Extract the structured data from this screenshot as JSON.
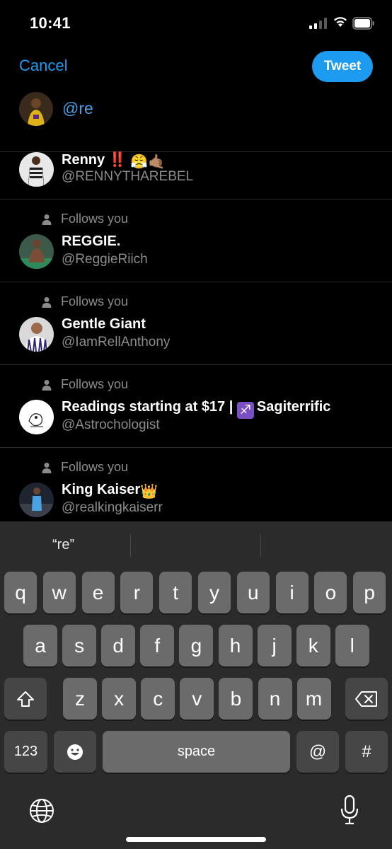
{
  "status_bar": {
    "time": "10:41"
  },
  "header": {
    "cancel_label": "Cancel",
    "tweet_label": "Tweet"
  },
  "compose": {
    "text": "@re"
  },
  "suggestions": [
    {
      "name": "Renny ‼️",
      "name_emoji": "😤🤙🏽",
      "handle": "@RENNYTHAREBEL",
      "follows_you": false
    },
    {
      "name": "REGGIE.",
      "handle": "@ReggieRiich",
      "follows_you": true,
      "follows_label": "Follows you"
    },
    {
      "name": "Gentle Giant",
      "handle": "@IamRellAnthony",
      "follows_you": true,
      "follows_label": "Follows you"
    },
    {
      "name": "Readings starting at $17 | ",
      "name_emoji": "♐",
      "name_suffix": "Sagiterrific",
      "handle": "@Astrochologist",
      "follows_you": true,
      "follows_label": "Follows you"
    },
    {
      "name": "King Kaiser",
      "name_emoji": "👑",
      "handle": "@realkingkaiserr",
      "follows_you": true,
      "follows_label": "Follows you"
    }
  ],
  "keyboard": {
    "prediction": "“re”",
    "row1": [
      "q",
      "w",
      "e",
      "r",
      "t",
      "y",
      "u",
      "i",
      "o",
      "p"
    ],
    "row2": [
      "a",
      "s",
      "d",
      "f",
      "g",
      "h",
      "j",
      "k",
      "l"
    ],
    "row3": [
      "z",
      "x",
      "c",
      "v",
      "b",
      "n",
      "m"
    ],
    "numbers_label": "123",
    "space_label": "space",
    "at_label": "@",
    "hash_label": "#"
  },
  "colors": {
    "accent": "#1d9bf0",
    "muted": "#8b8b8b",
    "background": "#000000"
  }
}
